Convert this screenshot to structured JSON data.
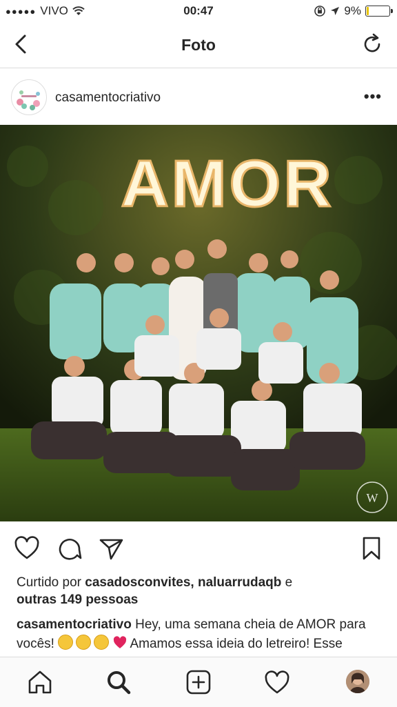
{
  "status_bar": {
    "signal_dots": "●●●●●",
    "carrier": "VIVO",
    "time": "00:47",
    "battery_percent": "9%",
    "battery_level": 0.09
  },
  "nav": {
    "title": "Foto",
    "back_icon": "chevron-left-icon",
    "refresh_icon": "refresh-icon"
  },
  "post": {
    "username": "casamentocriativo",
    "more_icon": "more-dots-icon",
    "photo": {
      "sign_text": "AMOR",
      "watermark": "W"
    },
    "likes": {
      "prefix": "Curtido por",
      "users": "casadosconvites, naluarrudaqb",
      "conj": "e",
      "others": "outras 149 pessoas"
    },
    "caption": {
      "user": "casamentocriativo",
      "text1": "Hey, uma semana cheia de AMOR para vocês!",
      "text2": "Amamos essa ideia do letreiro! Esse boquinho com os padrinhos e"
    }
  },
  "colors": {
    "accent_text": "#262626",
    "divider": "#dbdbdb",
    "battery_fill": "#e8c400",
    "heart_red": "#e0245e"
  }
}
